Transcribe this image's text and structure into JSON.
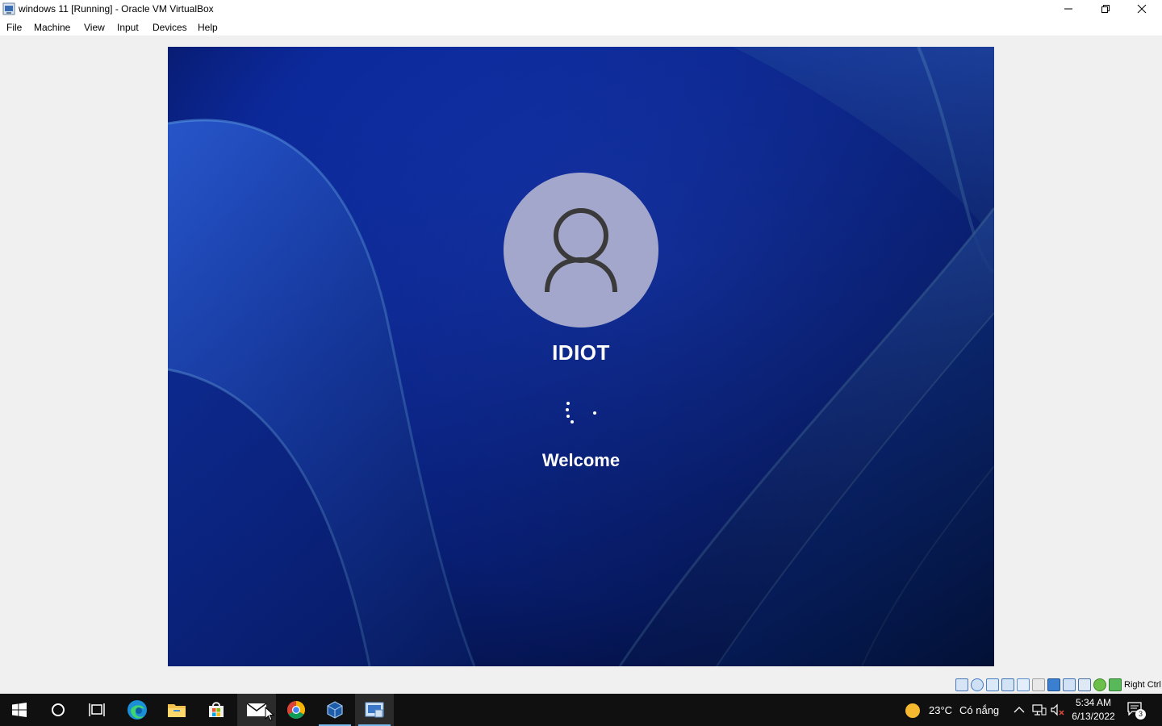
{
  "window": {
    "title": "windows 11 [Running] - Oracle VM VirtualBox",
    "controls": [
      "minimize",
      "restore",
      "close"
    ]
  },
  "menu": {
    "items": [
      {
        "label": "File"
      },
      {
        "label": "Machine"
      },
      {
        "label": "View"
      },
      {
        "label": "Input"
      },
      {
        "label": "Devices"
      },
      {
        "label": "Help"
      }
    ]
  },
  "vm": {
    "username": "IDIOT",
    "status": "Welcome",
    "avatar_icon": "user-icon",
    "background_color": "#0d2fa8"
  },
  "statusbar": {
    "host_key": "Right Ctrl",
    "icons": [
      "hard-disk-icon",
      "optical-drive-icon",
      "audio-icon",
      "network-icon",
      "usb-icon",
      "shared-folders-icon",
      "display-icon",
      "video-capture-icon",
      "virtualization-icon",
      "mouse-integration-icon",
      "keyboard-icon"
    ]
  },
  "taskbar": {
    "apps": [
      "start-icon",
      "search-icon",
      "task-view-icon",
      "edge-icon",
      "file-explorer-icon",
      "store-icon",
      "mail-icon",
      "chrome-icon",
      "virtualbox-icon",
      "vm-window-icon"
    ],
    "weather": {
      "temp": "23°C",
      "desc": "Có nắng",
      "icon": "sun-icon"
    },
    "clock": {
      "time": "5:34 AM",
      "date": "6/13/2022"
    },
    "notifications": "3"
  },
  "colors": {
    "accent": "#76b9ed",
    "taskbar": "#101010"
  }
}
